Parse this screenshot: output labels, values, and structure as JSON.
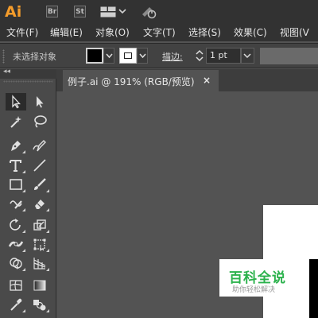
{
  "app": {
    "logo": "Ai",
    "bridge_label": "Br",
    "stock_label": "St",
    "brand_color": "#f49c2b"
  },
  "menu": [
    {
      "label": "文件(F)"
    },
    {
      "label": "编辑(E)"
    },
    {
      "label": "对象(O)"
    },
    {
      "label": "文字(T)"
    },
    {
      "label": "选择(S)"
    },
    {
      "label": "效果(C)"
    },
    {
      "label": "视图(V"
    }
  ],
  "control": {
    "selection_status": "未选择对象",
    "fill_color": "#000000",
    "stroke_color": "#ffffff",
    "stroke_label": "描边",
    "stroke_colon": ":",
    "stroke_weight": "1 pt"
  },
  "document": {
    "tab_title": "例子.ai @ 191% (RGB/预览)",
    "close_glyph": "×"
  },
  "tools": [
    {
      "name": "selection-tool-icon"
    },
    {
      "name": "direct-selection-tool-icon"
    },
    {
      "name": "magic-wand-tool-icon"
    },
    {
      "name": "lasso-tool-icon"
    },
    {
      "name": "pen-tool-icon"
    },
    {
      "name": "curvature-tool-icon"
    },
    {
      "name": "type-tool-icon"
    },
    {
      "name": "line-segment-tool-icon"
    },
    {
      "name": "rectangle-tool-icon"
    },
    {
      "name": "paintbrush-tool-icon"
    },
    {
      "name": "shaper-tool-icon"
    },
    {
      "name": "eraser-tool-icon"
    },
    {
      "name": "rotate-tool-icon"
    },
    {
      "name": "scale-tool-icon"
    },
    {
      "name": "width-tool-icon"
    },
    {
      "name": "free-transform-tool-icon"
    },
    {
      "name": "shape-builder-tool-icon"
    },
    {
      "name": "perspective-grid-tool-icon"
    },
    {
      "name": "mesh-tool-icon"
    },
    {
      "name": "gradient-tool-icon"
    },
    {
      "name": "eyedropper-tool-icon"
    },
    {
      "name": "blend-tool-icon"
    }
  ],
  "watermark": {
    "title": "百科全说",
    "subtitle": "助你轻松解决",
    "color": "#2bb24c"
  }
}
